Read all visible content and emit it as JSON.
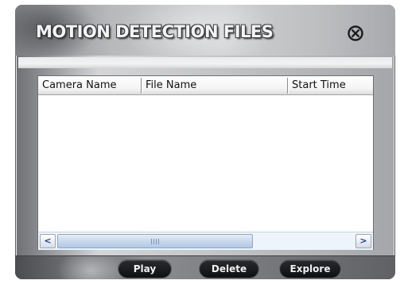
{
  "window": {
    "title": "MOTION DETECTION FILES"
  },
  "icons": {
    "close": "close-circle-x-icon",
    "scroll_left": "chevron-left-icon",
    "scroll_right": "chevron-right-icon"
  },
  "list": {
    "columns": [
      {
        "label": "Camera Name"
      },
      {
        "label": "File Name"
      },
      {
        "label": "Start Time"
      }
    ],
    "rows": [],
    "scroll_left_glyph": "<",
    "scroll_right_glyph": ">"
  },
  "buttons": {
    "play": "Play",
    "delete": "Delete",
    "explore": "Explore"
  },
  "colors": {
    "scroll_arrow": "#1a3f8a",
    "button_fill": "#0e0f11"
  }
}
